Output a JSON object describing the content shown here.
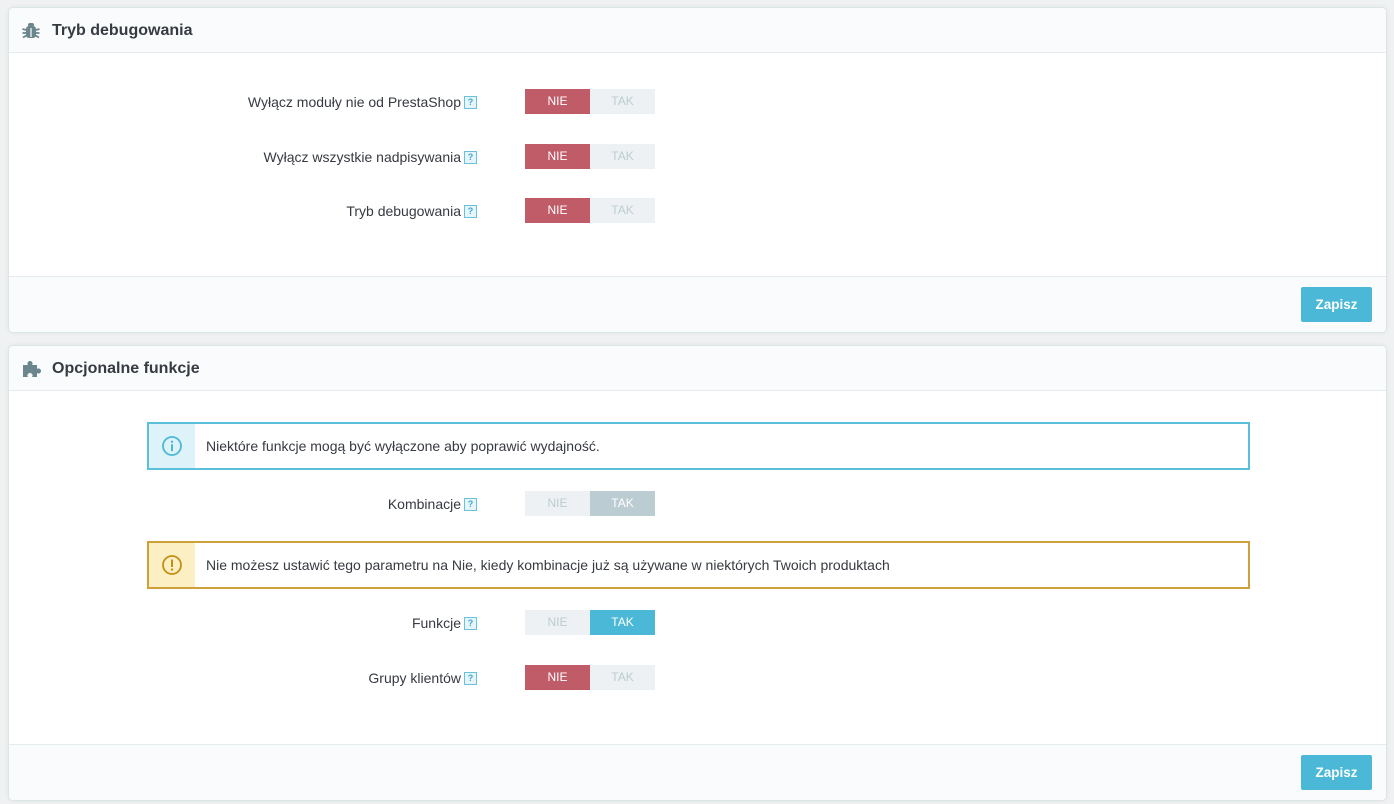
{
  "panels": [
    {
      "title": "Tryb debugowania",
      "icon": "bug-icon",
      "fields": [
        {
          "label": "Wyłącz moduły nie od PrestaShop",
          "no": "NIE",
          "yes": "TAK",
          "value": "NIE"
        },
        {
          "label": "Wyłącz wszystkie nadpisywania",
          "no": "NIE",
          "yes": "TAK",
          "value": "NIE"
        },
        {
          "label": "Tryb debugowania",
          "no": "NIE",
          "yes": "TAK",
          "value": "NIE"
        }
      ],
      "save_label": "Zapisz"
    },
    {
      "title": "Opcjonalne funkcje",
      "icon": "puzzle-icon",
      "info_alert": "Niektóre funkcje mogą być wyłączone aby poprawić wydajność.",
      "warning_alert": "Nie możesz ustawić tego parametru na Nie, kiedy kombinacje już są używane w niektórych Twoich produktach",
      "fields": [
        {
          "label": "Kombinacje",
          "no": "NIE",
          "yes": "TAK",
          "value": "TAK",
          "disabled": true
        },
        {
          "label": "Funkcje",
          "no": "NIE",
          "yes": "TAK",
          "value": "TAK"
        },
        {
          "label": "Grupy klientów",
          "no": "NIE",
          "yes": "TAK",
          "value": "NIE"
        }
      ],
      "save_label": "Zapisz"
    }
  ],
  "help_glyph": "?",
  "colors": {
    "accent": "#4ab8d6",
    "no_active": "#c05c67",
    "disabled_active": "#bbcdd2",
    "info_border": "#5bc0de",
    "warning_border": "#cda03a"
  }
}
